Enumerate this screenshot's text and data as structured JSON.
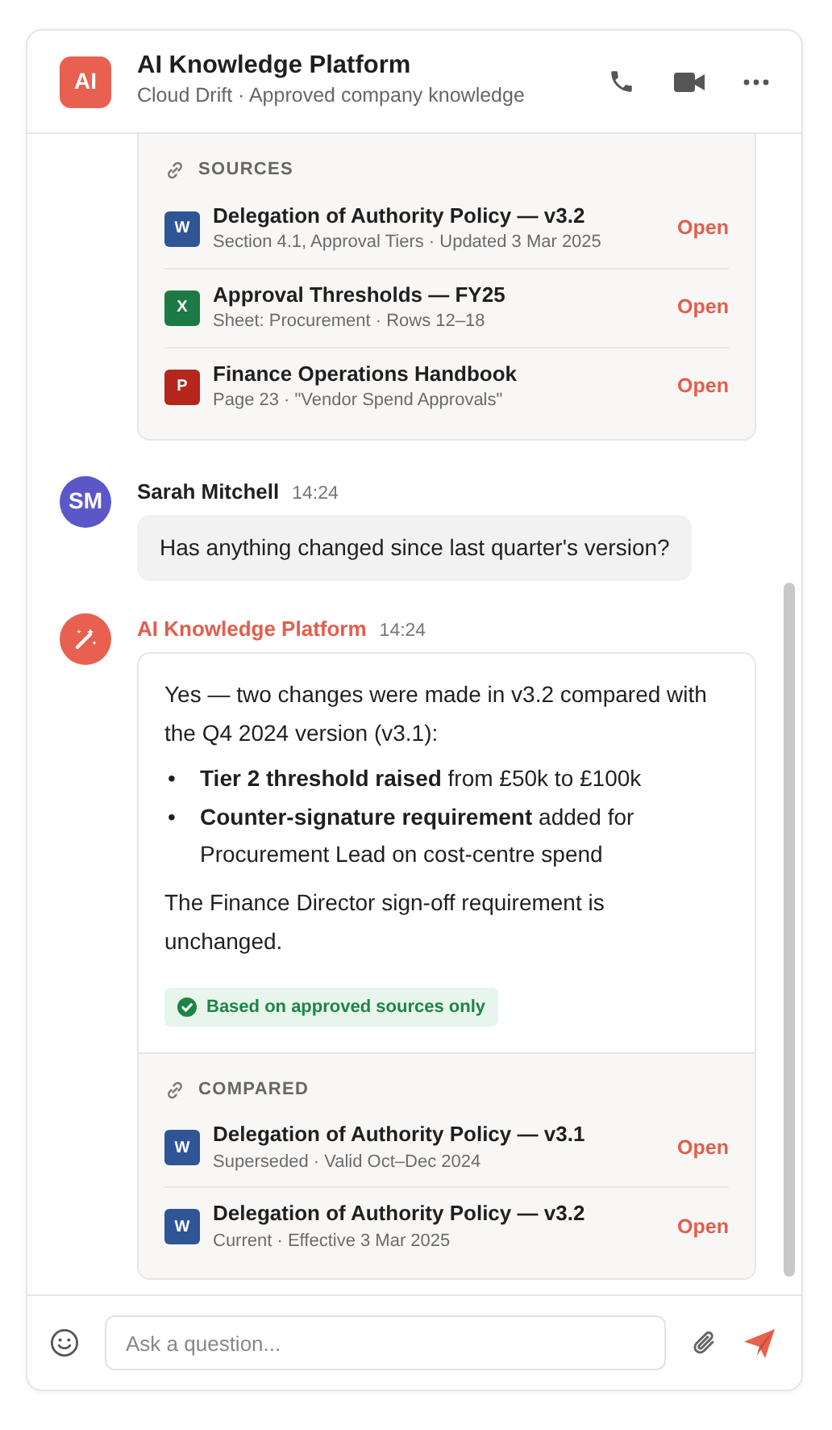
{
  "header": {
    "avatar": "AI",
    "title": "AI Knowledge Platform",
    "subtitle": "Cloud Drift · Approved company knowledge"
  },
  "messages": [
    {
      "kind": "assistant_tail",
      "section": {
        "label": "SOURCES",
        "files": [
          {
            "kind": "word",
            "letter": "W",
            "title": "Delegation of Authority Policy — v3.2",
            "meta": "Section 4.1, Approval Tiers · Updated 3 Mar 2025",
            "action": "Open"
          },
          {
            "kind": "excel",
            "letter": "X",
            "title": "Approval Thresholds — FY25",
            "meta": "Sheet: Procurement · Rows 12–18",
            "action": "Open"
          },
          {
            "kind": "pdf",
            "letter": "P",
            "title": "Finance Operations Handbook",
            "meta": "Page 23 · \"Vendor Spend Approvals\"",
            "action": "Open"
          }
        ]
      }
    },
    {
      "kind": "user",
      "initials": "SM",
      "author": "Sarah Mitchell",
      "time": "14:24",
      "text": "Has anything changed since last quarter's version?"
    },
    {
      "kind": "assistant",
      "author": "AI Knowledge Platform",
      "time": "14:24",
      "intro": "Yes — two changes were made in v3.2 compared with the Q4 2024 version (v3.1):",
      "bullets": [
        {
          "marker": "•",
          "text": "**Tier 2 threshold raised** from £50k to £100k"
        },
        {
          "marker": "•",
          "text": "**Counter-signature requirement** added for Procurement Lead on cost-centre spend"
        }
      ],
      "outro": "The Finance Director sign-off requirement is unchanged.",
      "badge": "Based on approved sources only",
      "section": {
        "label": "COMPARED",
        "files": [
          {
            "kind": "word",
            "letter": "W",
            "title": "Delegation of Authority Policy — v3.1",
            "meta": "Superseded · Valid Oct–Dec 2024",
            "action": "Open"
          },
          {
            "kind": "word",
            "letter": "W",
            "title": "Delegation of Authority Policy — v3.2",
            "meta": "Current · Effective 3 Mar 2025",
            "action": "Open"
          }
        ]
      }
    }
  ],
  "composer": {
    "placeholder": "Ask a question..."
  }
}
